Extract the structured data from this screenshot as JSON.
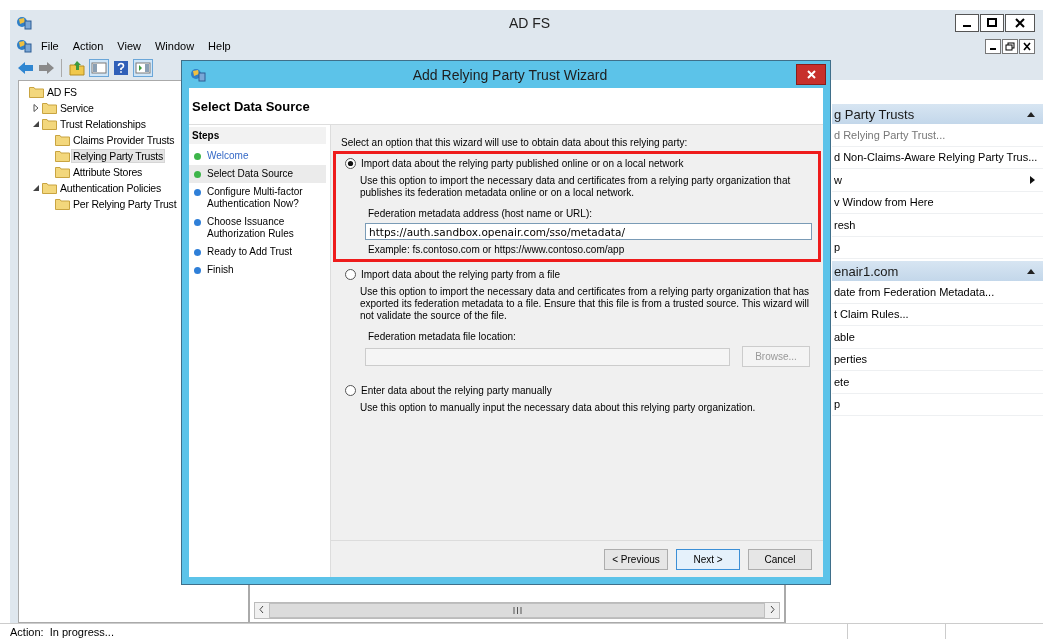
{
  "window": {
    "title": "AD FS",
    "menu": [
      "File",
      "Action",
      "View",
      "Window",
      "Help"
    ]
  },
  "tree": [
    {
      "label": "AD FS",
      "selected": false,
      "children": [
        {
          "label": "Service",
          "selected": false,
          "expanded": false
        },
        {
          "label": "Trust Relationships",
          "selected": false,
          "expanded": true,
          "children": [
            {
              "label": "Claims Provider Trusts",
              "selected": false
            },
            {
              "label": "Relying Party Trusts",
              "selected": true
            },
            {
              "label": "Attribute Stores",
              "selected": false
            }
          ]
        },
        {
          "label": "Authentication Policies",
          "selected": false,
          "expanded": true,
          "children": [
            {
              "label": "Per Relying Party Trust",
              "selected": false
            }
          ]
        }
      ]
    }
  ],
  "actions": [
    {
      "title": "g Party Trusts",
      "items": [
        {
          "label": "d Relying Party Trust...",
          "disabled": true,
          "submenu": false
        },
        {
          "label": "d Non-Claims-Aware Relying Party Trus...",
          "disabled": false,
          "submenu": false
        },
        {
          "label": "w",
          "disabled": false,
          "submenu": true
        },
        {
          "label": "v Window from Here",
          "disabled": false,
          "submenu": false
        },
        {
          "label": "resh",
          "disabled": false,
          "submenu": false
        },
        {
          "label": "p",
          "disabled": false,
          "submenu": false
        }
      ]
    },
    {
      "title": "enair1.com",
      "items": [
        {
          "label": "date from Federation Metadata...",
          "disabled": false,
          "submenu": false
        },
        {
          "label": "t Claim Rules...",
          "disabled": false,
          "submenu": false
        },
        {
          "label": "able",
          "disabled": false,
          "submenu": false
        },
        {
          "label": "perties",
          "disabled": false,
          "submenu": false
        },
        {
          "label": "ete",
          "disabled": false,
          "submenu": false
        },
        {
          "label": "p",
          "disabled": false,
          "submenu": false
        }
      ]
    }
  ],
  "status_bar": {
    "text": "Action:  In progress..."
  },
  "wizard": {
    "title": "Add Relying Party Trust Wizard",
    "page_title": "Select Data Source",
    "steps_title": "Steps",
    "steps": [
      {
        "label": "Welcome",
        "color": "#3db54a",
        "selected": false,
        "link": true
      },
      {
        "label": "Select Data Source",
        "color": "#3db54a",
        "selected": true,
        "link": false
      },
      {
        "label": "Configure Multi-factor Authentication Now?",
        "color": "#2f7fd8",
        "selected": false,
        "link": false
      },
      {
        "label": "Choose Issuance Authorization Rules",
        "color": "#2f7fd8",
        "selected": false,
        "link": false
      },
      {
        "label": "Ready to Add Trust",
        "color": "#2f7fd8",
        "selected": false,
        "link": false
      },
      {
        "label": "Finish",
        "color": "#2f7fd8",
        "selected": false,
        "link": false
      }
    ],
    "intro": "Select an option that this wizard will use to obtain data about this relying party:",
    "options": [
      {
        "label": "Import data about the relying party published online or on a local network",
        "selected": true,
        "highlighted": true,
        "description": "Use this option to import the necessary data and certificates from a relying party organization that publishes its federation metadata online or on a local network.",
        "field": {
          "label": "Federation metadata address (host name or URL):",
          "value": "https://auth.sandbox.openair.com/sso/metadata/",
          "disabled": false
        },
        "example": "Example: fs.contoso.com or https://www.contoso.com/app"
      },
      {
        "label": "Import data about the relying party from a file",
        "selected": false,
        "highlighted": false,
        "description": "Use this option to import the necessary data and certificates from a relying party organization that has exported its federation metadata to a file. Ensure that this file is from a trusted source.  This wizard will not validate the source of the file.",
        "field": {
          "label": "Federation metadata file location:",
          "disabled": true,
          "button": "Browse..."
        }
      },
      {
        "label": "Enter data about the relying party manually",
        "selected": false,
        "highlighted": false,
        "description": "Use this option to manually input the necessary data about this relying party organization."
      }
    ],
    "buttons": [
      {
        "label": "< Previous",
        "default": false
      },
      {
        "label": "Next >",
        "default": true
      },
      {
        "label": "Cancel",
        "default": false
      }
    ]
  }
}
